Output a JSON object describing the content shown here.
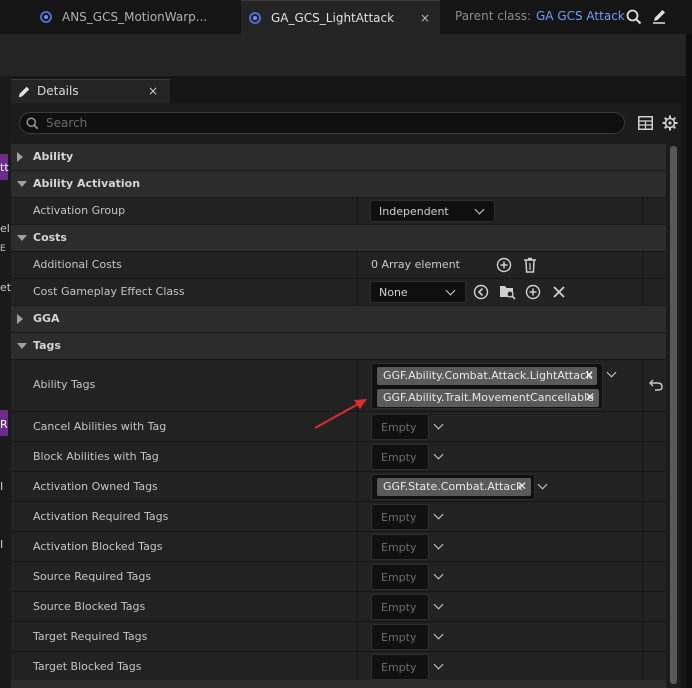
{
  "tabs": [
    {
      "label": "ANS_GCS_MotionWarp..."
    },
    {
      "label": "GA_GCS_LightAttack",
      "close": "×"
    }
  ],
  "parent_class": {
    "label": "Parent class:",
    "value": "GA GCS Attack"
  },
  "left_fragments": [
    "tt",
    "el",
    "E",
    "et",
    "R",
    "I",
    "I"
  ],
  "details": {
    "tab_label": "Details",
    "tab_close": "×",
    "search_placeholder": "Search",
    "categories": {
      "ability": "Ability",
      "ability_activation": "Ability Activation",
      "costs": "Costs",
      "gga": "GGA",
      "tags": "Tags"
    },
    "activation_group": {
      "label": "Activation Group",
      "value": "Independent"
    },
    "additional_costs": {
      "label": "Additional Costs",
      "value": "0 Array element"
    },
    "cost_ge_class": {
      "label": "Cost Gameplay Effect Class",
      "value": "None"
    },
    "ability_tags": {
      "label": "Ability Tags",
      "tags": [
        "GGF.Ability.Combat.Attack.LightAttack",
        "GGF.Ability.Trait.MovementCancellable"
      ]
    },
    "tag_rows": [
      {
        "label": "Cancel Abilities with Tag",
        "value": "Empty"
      },
      {
        "label": "Block Abilities with Tag",
        "value": "Empty"
      },
      {
        "label": "Activation Owned Tags",
        "tag": "GGF.State.Combat.Attack"
      },
      {
        "label": "Activation Required Tags",
        "value": "Empty"
      },
      {
        "label": "Activation Blocked Tags",
        "value": "Empty"
      },
      {
        "label": "Source Required Tags",
        "value": "Empty"
      },
      {
        "label": "Source Blocked Tags",
        "value": "Empty"
      },
      {
        "label": "Target Required Tags",
        "value": "Empty"
      },
      {
        "label": "Target Blocked Tags",
        "value": "Empty"
      }
    ]
  },
  "colors": {
    "accent_link": "#6f9ff6",
    "annotation_arrow": "#e02b2b",
    "tag_chip": "#5a5a5a"
  }
}
